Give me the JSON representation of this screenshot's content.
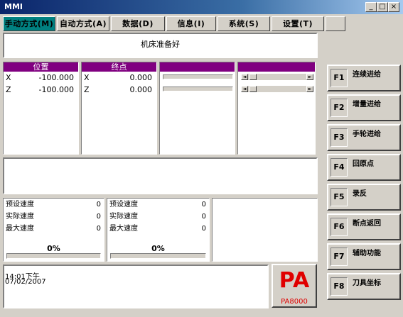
{
  "window": {
    "title": "MMI",
    "controls": [
      "_",
      "□",
      "×"
    ]
  },
  "menu": [
    {
      "label": "手动方式(M)",
      "active": true
    },
    {
      "label": "自动方式(A)",
      "active": false
    },
    {
      "label": "数据(D)",
      "active": false
    },
    {
      "label": "信息(I)",
      "active": false
    },
    {
      "label": "系统(S)",
      "active": false
    },
    {
      "label": "设置(T)",
      "active": false
    },
    {
      "label": "",
      "active": false
    }
  ],
  "status_message": "机床准备好",
  "position": {
    "header": "位置",
    "rows": [
      {
        "axis": "X",
        "value": "-100.000"
      },
      {
        "axis": "Z",
        "value": "-100.000"
      }
    ]
  },
  "endpoint": {
    "header": "终点",
    "rows": [
      {
        "axis": "X",
        "value": "0.000"
      },
      {
        "axis": "Z",
        "value": "0.000"
      }
    ]
  },
  "speed_panels": [
    {
      "rows": [
        {
          "label": "预设速度",
          "value": "0"
        },
        {
          "label": "实际速度",
          "value": "0"
        },
        {
          "label": "最大速度",
          "value": "0"
        }
      ],
      "percent": "0%"
    },
    {
      "rows": [
        {
          "label": "预设速度",
          "value": "0"
        },
        {
          "label": "实际速度",
          "value": "0"
        },
        {
          "label": "最大速度",
          "value": "0"
        }
      ],
      "percent": "0%"
    }
  ],
  "clock": {
    "time": "14:01下午",
    "date": "07/02/2007"
  },
  "logo": {
    "text": "PA",
    "model": "PA8000",
    "color": "#e00000"
  },
  "function_keys": [
    {
      "key": "F1",
      "label": "连续进给"
    },
    {
      "key": "F2",
      "label": "增量进给"
    },
    {
      "key": "F3",
      "label": "手轮进给"
    },
    {
      "key": "F4",
      "label": "回原点"
    },
    {
      "key": "F5",
      "label": "录反"
    },
    {
      "key": "F6",
      "label": "断点返回"
    },
    {
      "key": "F7",
      "label": "辅助功能"
    },
    {
      "key": "F8",
      "label": "刀具坐标"
    }
  ],
  "colors": {
    "active_tab": "#008080",
    "column_header": "#800080"
  }
}
